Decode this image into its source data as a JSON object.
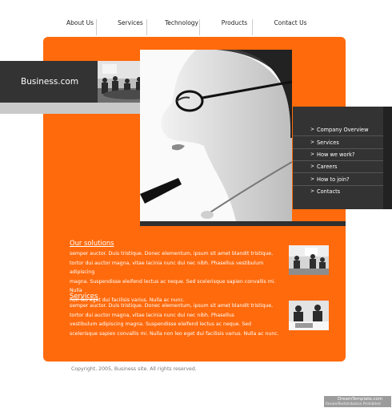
{
  "nav": {
    "items": [
      {
        "label": "About Us"
      },
      {
        "label": "Services"
      },
      {
        "label": "Technology"
      },
      {
        "label": "Products"
      },
      {
        "label": "Contact Us"
      }
    ]
  },
  "brand": {
    "name": "Business.com"
  },
  "menu": {
    "items": [
      {
        "label": "Company Overview"
      },
      {
        "label": "Services"
      },
      {
        "label": "How we work?"
      },
      {
        "label": "Careers"
      },
      {
        "label": "How to join?"
      },
      {
        "label": "Contacts"
      }
    ],
    "arrow": ">"
  },
  "sections": [
    {
      "title": "Our solutions",
      "lines": [
        "semper auctor. Duis tristique. Donec elementum, ipsum sit amet blandit tristique,",
        "tortor dui auctor magna, vitae lacinia nunc dui nec nibh. Phasellus vestibulum adipiscing",
        "magna. Suspendisse eleifend lectus ac neque. Sed scelerisque sapien convallis mi. Nulla",
        "non leo eget dui facilisis varius. Nulla ac nunc."
      ]
    },
    {
      "title": "Services",
      "lines": [
        "semper auctor. Duis tristique. Donec elementum, ipsum sit amet blandit tristique,",
        "tortor dui auctor magna, vitae lacinia nunc dui nec nibh. Phasellus",
        "vestibulum adipiscing magna. Suspendisse eleifend lectus ac neque. Sed",
        "scelerisque sapien convallis mi. Nulla non leo eget dui facilisis varius. Nulla ac nunc."
      ]
    }
  ],
  "footer": {
    "copyright": "Copyright, 2005, Business site. All rights reserved."
  },
  "watermark": {
    "line1": "DreamTemplate.com",
    "line2": "Resale/Redistribution Prohibited"
  },
  "colors": {
    "orange": "#ff6a0c",
    "dark": "#333333"
  }
}
